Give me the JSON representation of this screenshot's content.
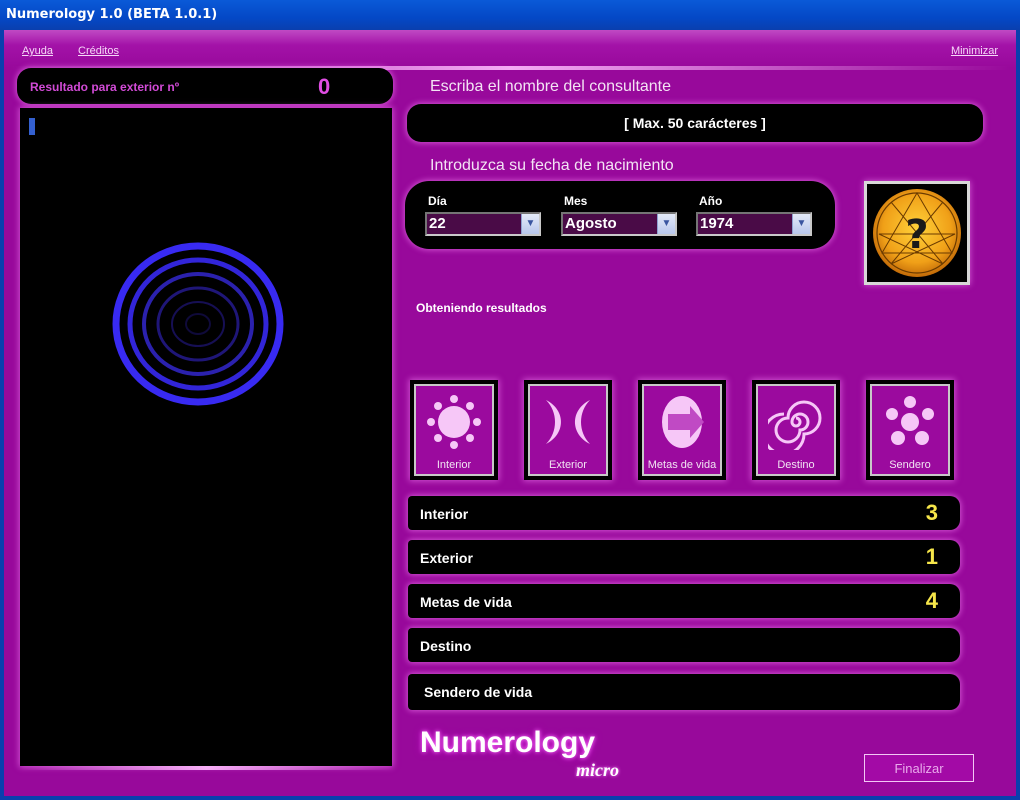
{
  "window": {
    "title": "Numerology 1.0 (BETA 1.0.1)"
  },
  "menu": {
    "help": "Ayuda",
    "credits": "Créditos",
    "minimize": "Minimizar"
  },
  "result": {
    "label": "Resultado para exterior nº",
    "value": "0"
  },
  "name_section": {
    "heading": "Escriba el nombre del consultante",
    "placeholder": "[ Max. 50 carácteres ]"
  },
  "birth_section": {
    "heading": "Introduzca su fecha de nacimiento",
    "day_label": "Día",
    "day_value": "22",
    "month_label": "Mes",
    "month_value": "Agosto",
    "year_label": "Año",
    "year_value": "1974"
  },
  "status": "Obteniendo resultados",
  "cards": [
    {
      "label": "Interior",
      "icon": "sun-icon"
    },
    {
      "label": "Exterior",
      "icon": "crescents-icon"
    },
    {
      "label": "Metas de vida",
      "icon": "arrow-oval-icon"
    },
    {
      "label": "Destino",
      "icon": "spiral-icon"
    },
    {
      "label": "Sendero",
      "icon": "circles-icon"
    }
  ],
  "results": [
    {
      "label": "Interior",
      "value": "3"
    },
    {
      "label": "Exterior",
      "value": "1"
    },
    {
      "label": "Metas de vida",
      "value": "4"
    },
    {
      "label": "Destino",
      "value": ""
    },
    {
      "label": "Sendero de vida",
      "value": ""
    }
  ],
  "brand": {
    "name": "Numerology",
    "edition": "micro"
  },
  "buttons": {
    "finalize": "Finalizar"
  },
  "colors": {
    "background": "#98099b",
    "result_number": "#f6e64a",
    "title_bar": "#0448c6"
  }
}
